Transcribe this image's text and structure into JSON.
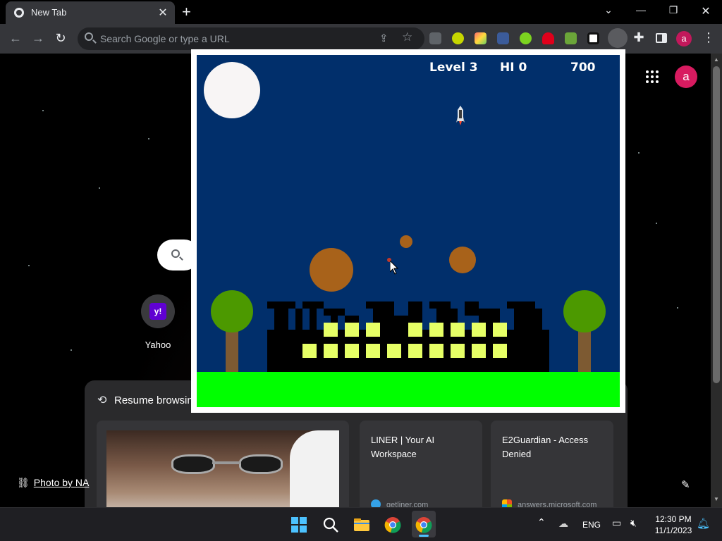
{
  "browser": {
    "tab": {
      "title": "New Tab"
    },
    "omnibox": {
      "placeholder": "Search Google or type a URL"
    },
    "profile_initial": "a"
  },
  "ntp": {
    "shortcuts": [
      {
        "label": "Yahoo",
        "logo_text": "y!"
      }
    ],
    "profile_initial": "a",
    "resume": {
      "title": "Resume browsin",
      "cards": [
        {
          "title": "LINER | Your AI Workspace",
          "url": "getliner.com"
        },
        {
          "title": "E2Guardian - Access Denied",
          "url": "answers.microsoft.com"
        }
      ]
    },
    "photo_credit": "Photo by NA"
  },
  "game": {
    "level": "Level 3",
    "hi": "HI 0",
    "score": "700",
    "colors": {
      "sky": "#012f6b",
      "ground": "#00ff00",
      "window": "#e6ff66",
      "meteor": "#a8621a",
      "tree": "#4c9900"
    }
  },
  "taskbar": {
    "language": "ENG",
    "time": "12:30 PM",
    "date": "11/1/2023"
  },
  "icons": [
    "chrome-icon",
    "close-icon",
    "plus-icon",
    "back-icon",
    "forward-icon",
    "reload-icon",
    "search-icon",
    "share-icon",
    "star-icon",
    "extensions-icon",
    "sidepanel-icon",
    "menu-icon",
    "apps-icon",
    "edit-icon",
    "link-icon",
    "windows-start-icon",
    "file-explorer-icon",
    "notification-icon"
  ]
}
